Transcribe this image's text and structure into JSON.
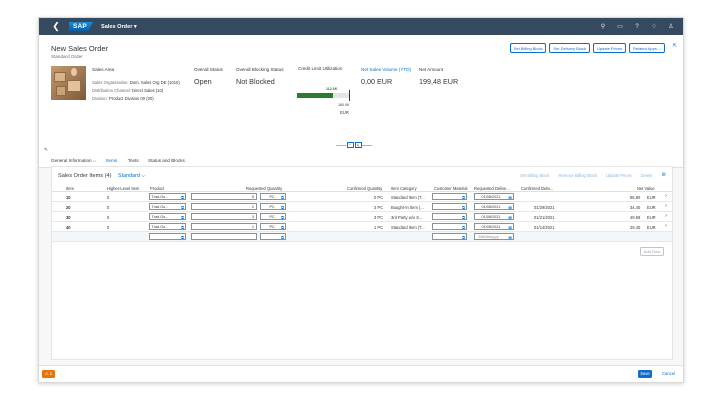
{
  "shell": {
    "logo": "SAP",
    "app_title": "Sales Order ▾"
  },
  "header": {
    "title": "New Sales Order",
    "subtitle": "Standard Order",
    "buttons": [
      "Set Billing Block",
      "Set Delivery Block",
      "Update Prices",
      "Related Apps ⌵"
    ],
    "sales_area": {
      "heading": "Sales Area",
      "sales_org_label": "Sales Organization:",
      "sales_org_value": "Dom. Sales Org DE (1010)",
      "dist_channel_label": "Distribution Channel:",
      "dist_channel_value": "Direct Sales (10)",
      "division_label": "Division:",
      "division_value": "Product Division 00 (00)"
    },
    "overall_status": {
      "label": "Overall Status",
      "value": "Open"
    },
    "blocking_status": {
      "label": "Overall Blocking Status",
      "value": "Not Blocked"
    },
    "credit": {
      "label": "Credit Limit Utilization",
      "bar_label": "112.6K",
      "limit": "160.0K",
      "currency": "EUR",
      "utilization": 0.7
    },
    "net_sales": {
      "label": "Net Sales Volume (YTD)",
      "value": "0,00 EUR"
    },
    "net_amount": {
      "label": "Net Amount",
      "value": "199,48 EUR"
    }
  },
  "tabs": [
    "General Information ⌵",
    "Items",
    "Texts",
    "Status and Blocks"
  ],
  "table": {
    "title": "Sales Order Items (4)",
    "variant": "Standard ⌵",
    "actions": [
      "Set Billing Block",
      "Remove Billing Block",
      "Update Prices",
      "Delete"
    ],
    "columns": [
      "Item",
      "Higher-Level Item",
      "Product",
      "Requested Quantity",
      "Confirmed Quantity",
      "Item Category",
      "Customer Material",
      "Requested Delive...",
      "Confirmed Deliv...",
      "Net Value"
    ],
    "rows": [
      {
        "item": "10",
        "higher": "0",
        "product": "Trad.Go...",
        "qty": "5",
        "unit": "PC",
        "confirmed": "0 PC",
        "category": "Standard Item (T...",
        "req_date": "01/08/2021",
        "conf_date": "",
        "net": "85,90",
        "cur": "EUR"
      },
      {
        "item": "20",
        "higher": "0",
        "product": "Trad.Go...",
        "qty": "2",
        "unit": "PC",
        "confirmed": "2 PC",
        "category": "Bought-In Item (...",
        "req_date": "01/08/2021",
        "conf_date": "01/29/2021",
        "net": "34,40",
        "cur": "EUR"
      },
      {
        "item": "30",
        "higher": "0",
        "product": "Trad.Go...",
        "qty": "3",
        "unit": "PC",
        "confirmed": "3 PC",
        "category": "3rd Party w/o S...",
        "req_date": "01/08/2021",
        "conf_date": "01/21/2021",
        "net": "49,58",
        "cur": "EUR"
      },
      {
        "item": "40",
        "higher": "0",
        "product": "Trad.Go...",
        "qty": "1",
        "unit": "PC",
        "confirmed": "1 PC",
        "category": "Standard Item (T...",
        "req_date": "01/08/2021",
        "conf_date": "01/14/2021",
        "net": "29,40",
        "cur": "EUR"
      }
    ],
    "new_row_date_placeholder": "MM/dd/yyyy",
    "add_row": "Add Row"
  },
  "footer": {
    "warning_count": "⚠ 1",
    "save": "Save",
    "cancel": "Cancel"
  }
}
